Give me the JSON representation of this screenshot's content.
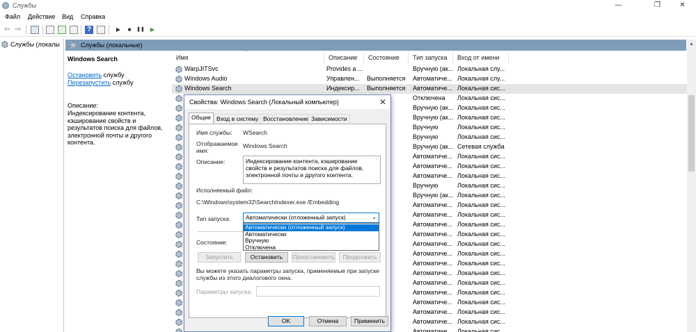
{
  "window": {
    "title": "Службы",
    "controls": {
      "minimize": "—",
      "maximize": "❐",
      "close": "✕"
    }
  },
  "menu": [
    "Файл",
    "Действие",
    "Вид",
    "Справка"
  ],
  "toolbar": {
    "icons": [
      "back-icon",
      "forward-icon",
      "show-hide-tree-icon",
      "properties-icon",
      "refresh-icon",
      "export-icon",
      "help-icon",
      "console-icon",
      "start-icon",
      "stop-icon",
      "pause-icon",
      "restart-icon"
    ],
    "glyphs": {
      "back": "⇦",
      "forward": "⇨",
      "start": "▶",
      "stop": "■",
      "pause": "❚❚",
      "restart": "▶"
    }
  },
  "tree": {
    "item": "Службы (локалы"
  },
  "pane": {
    "title": "Службы (локальные)"
  },
  "description_pane": {
    "service_name": "Windows Search",
    "stop_link": "Остановить",
    "stop_suffix": " службу",
    "restart_link": "Перезапустить",
    "restart_suffix": " службу",
    "description_label": "Описание:",
    "description_text": "Индексирование контента, кэширование свойств и результатов поиска для файлов, электронной почты и другого контента."
  },
  "columns": [
    "Имя",
    "Описание",
    "Состояние",
    "Тип запуска",
    "Вход от имени"
  ],
  "sort_glyph": "^",
  "rows": [
    {
      "name": "WarpJITSvc",
      "desc": "Provides a ...",
      "state": "",
      "startup": "Вручную (ак...",
      "logon": "Локальная слу..."
    },
    {
      "name": "Windows Audio",
      "desc": "Управлен...",
      "state": "Выполняется",
      "startup": "Автоматиче...",
      "logon": "Локальная слу..."
    },
    {
      "name": "Windows Search",
      "desc": "Индексир...",
      "state": "Выполняется",
      "startup": "Автоматиче...",
      "logon": "Локальная сис...",
      "selected": true
    },
    {
      "name": "",
      "desc": "",
      "state": "",
      "startup": "Отключена",
      "logon": "Локальная сис..."
    },
    {
      "name": "",
      "desc": "",
      "state": "",
      "startup": "Вручную (ак...",
      "logon": "Локальная сис..."
    },
    {
      "name": "",
      "desc": "",
      "state": "",
      "startup": "Вручную (ак...",
      "logon": "Локальная сис..."
    },
    {
      "name": "",
      "desc": "",
      "state": "",
      "startup": "Вручную",
      "logon": "Локальная сис..."
    },
    {
      "name": "",
      "desc": "",
      "state": "",
      "startup": "Вручную",
      "logon": "Локальная сис..."
    },
    {
      "name": "",
      "desc": "",
      "state": "...яется",
      "startup": "Вручную (ак...",
      "logon": "Сетевая служба"
    },
    {
      "name": "",
      "desc": "",
      "state": "...яется",
      "startup": "Автоматиче...",
      "logon": "Локальная сис..."
    },
    {
      "name": "",
      "desc": "",
      "state": "...яется",
      "startup": "Автоматиче...",
      "logon": "Локальная сис..."
    },
    {
      "name": "",
      "desc": "",
      "state": "...яется",
      "startup": "Автоматиче...",
      "logon": "Локальная сис..."
    },
    {
      "name": "",
      "desc": "",
      "state": "...яется",
      "startup": "Вручную",
      "logon": "Локальная сис..."
    },
    {
      "name": "",
      "desc": "",
      "state": "...яется",
      "startup": "Вручную (ак...",
      "logon": "Локальная сис..."
    },
    {
      "name": "",
      "desc": "",
      "state": "...яется",
      "startup": "Автоматиче...",
      "logon": "Локальная сис..."
    },
    {
      "name": "",
      "desc": "",
      "state": "...яется",
      "startup": "Автоматиче...",
      "logon": "Локальная сис..."
    },
    {
      "name": "",
      "desc": "",
      "state": "...яется",
      "startup": "Автоматиче...",
      "logon": "Локальная сис..."
    },
    {
      "name": "",
      "desc": "",
      "state": "...яется",
      "startup": "Автоматиче...",
      "logon": "Локальная сис..."
    },
    {
      "name": "",
      "desc": "",
      "state": "...яется",
      "startup": "Автоматиче...",
      "logon": "Локальная сис..."
    },
    {
      "name": "",
      "desc": "",
      "state": "...яется",
      "startup": "Автоматиче...",
      "logon": "Локальная сис..."
    },
    {
      "name": "",
      "desc": "",
      "state": "...яется",
      "startup": "Автоматиче...",
      "logon": "Локальная сис..."
    },
    {
      "name": "",
      "desc": "",
      "state": "...яется",
      "startup": "Автоматиче...",
      "logon": "Локальная сис..."
    },
    {
      "name": "",
      "desc": "",
      "state": "...яется",
      "startup": "Автоматиче...",
      "logon": "Локальная сис..."
    },
    {
      "name": "",
      "desc": "",
      "state": "...яется",
      "startup": "Автоматиче...",
      "logon": "Локальная сис..."
    },
    {
      "name": "",
      "desc": "",
      "state": "...яется",
      "startup": "Автоматиче...",
      "logon": "Локальная сис..."
    },
    {
      "name": "",
      "desc": "",
      "state": "...яется",
      "startup": "Автоматиче...",
      "logon": "Локальная сис..."
    },
    {
      "name": "",
      "desc": "",
      "state": "...яется",
      "startup": "Автоматиче...",
      "logon": "Локальная сис..."
    },
    {
      "name": "",
      "desc": "",
      "state": "...яется",
      "startup": "Автоматиче...",
      "logon": "Локальная сис..."
    }
  ],
  "dialog": {
    "title": "Свойства: Windows Search (Локальный компьютер)",
    "close_glyph": "✕",
    "tabs": [
      "Общие",
      "Вход в систему",
      "Восстановление",
      "Зависимости"
    ],
    "service_name_label": "Имя службы:",
    "service_name_value": "WSearch",
    "display_name_label_1": "Отображаемое",
    "display_name_label_2": "имя:",
    "display_name_value": "Windows Search",
    "description_label": "Описание:",
    "description_value": "Индексирование контента, кэширование свойств и результатов поиска для файлов, электронной почты и другого контента.",
    "exe_label": "Исполняемый файл:",
    "exe_value": "C:\\Windows\\system32\\SearchIndexer.exe /Embedding",
    "startup_label": "Тип запуска:",
    "startup_value": "Автоматически (отложенный запуск)",
    "startup_options": [
      "Автоматически (отложенный запуск)",
      "Автоматически",
      "Вручную",
      "Отключена"
    ],
    "status_label": "Состояние:",
    "buttons": {
      "start": "Запустить",
      "stop": "Остановить",
      "pause": "Приостановить",
      "resume": "Продолжить"
    },
    "hint_line1": "Вы можете указать параметры запуска, применяемые при запуске",
    "hint_line2": "службы из этого диалогового окна.",
    "params_label": "Параметры запуска:",
    "params_value": "",
    "ok": "OK",
    "cancel": "Отмена",
    "apply": "Применить"
  }
}
